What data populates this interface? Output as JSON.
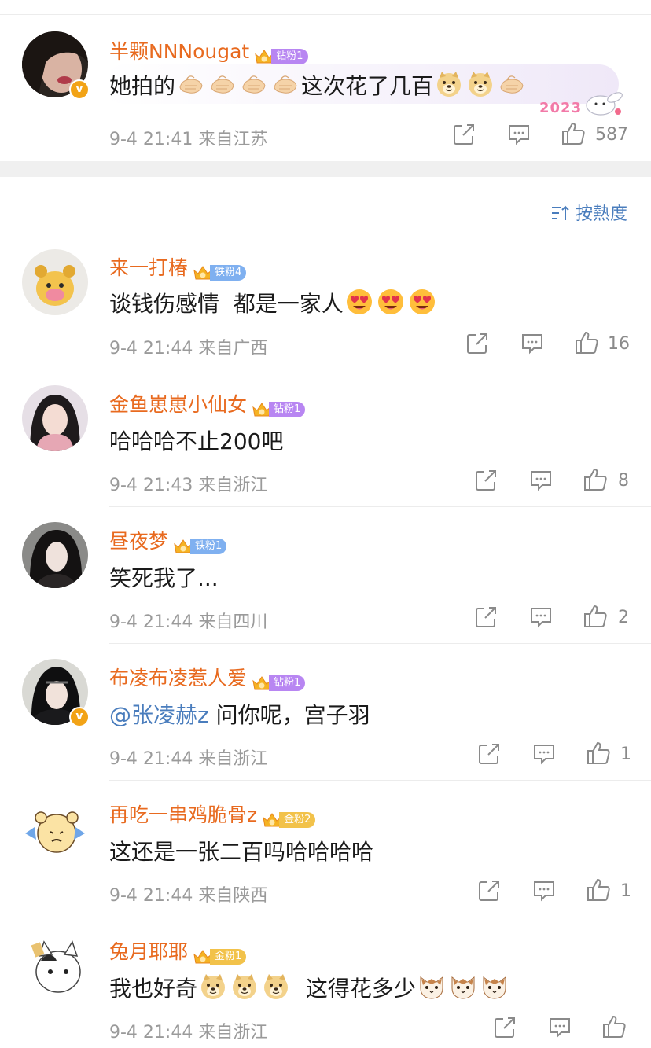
{
  "sort": {
    "label": "按熱度"
  },
  "stamp": "2023",
  "comments": [
    {
      "username": "半颗NNNougat",
      "badge": "钻粉1",
      "text_parts": [
        "她拍的",
        "这次花了几百"
      ],
      "meta": "9-4 21:41 来自江苏",
      "likes": "587"
    },
    {
      "username": "来一打椿",
      "badge": "铁粉4",
      "text": "谈钱伤感情  都是一家人",
      "meta": "9-4 21:44 来自广西",
      "likes": "16"
    },
    {
      "username": "金鱼崽崽小仙女",
      "badge": "钻粉1",
      "text": "哈哈哈不止200吧",
      "meta": "9-4 21:43 来自浙江",
      "likes": "8"
    },
    {
      "username": "昼夜梦",
      "badge": "铁粉1",
      "text": "笑死我了...",
      "meta": "9-4 21:44 来自四川",
      "likes": "2"
    },
    {
      "username": "布凌布凌惹人爱",
      "badge": "钻粉1",
      "mention": "@张凌赫z",
      "text": " 问你呢，宫子羽",
      "meta": "9-4 21:44 来自浙江",
      "likes": "1"
    },
    {
      "username": "再吃一串鸡脆骨z",
      "badge": "金粉2",
      "text": "这还是一张二百吗哈哈哈哈",
      "meta": "9-4 21:44 来自陕西",
      "likes": "1"
    },
    {
      "username": "兔月耶耶",
      "badge": "金粉1",
      "text_parts": [
        "我也好奇",
        "  这得花多少"
      ],
      "meta": "9-4 21:44 来自浙江",
      "likes": ""
    }
  ],
  "icons": {
    "share": "share-icon",
    "comment": "comment-icon",
    "like": "like-icon",
    "verified": "verified-badge-icon",
    "crown": "crown-icon"
  },
  "colors": {
    "username": "#e86a1f",
    "mention": "#4a7dbd",
    "meta": "#9a9a9a",
    "diamond_fan": "#b886f2",
    "iron_fan": "#7fb0f0",
    "gold_fan": "#f2c24a"
  }
}
